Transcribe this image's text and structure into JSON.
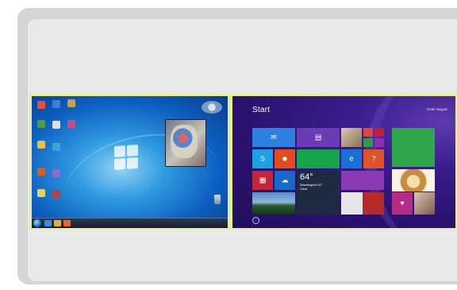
{
  "win7": {
    "taskbar": {
      "tray_text": ""
    },
    "desktop_icon_colors": [
      "#e84d3d",
      "#3f7fd9",
      "#c6a04a",
      "#4d9e3a",
      "#e0e0e0",
      "#c94c8a",
      "#e8c04a",
      "#3aa6d6",
      "#d95a2a",
      "#8e6cc9",
      "#e0d460",
      "#b44242"
    ]
  },
  "win8": {
    "title": "Start",
    "user_name": "Vivek Nayyar",
    "weather": {
      "temperature": "64°",
      "city": "Washington DC",
      "condition": "Clear"
    }
  },
  "colors": {
    "frame_highlight": "#e7ec9c",
    "win8_background": "#2a1270",
    "win7_background": "#0d5fc1"
  }
}
